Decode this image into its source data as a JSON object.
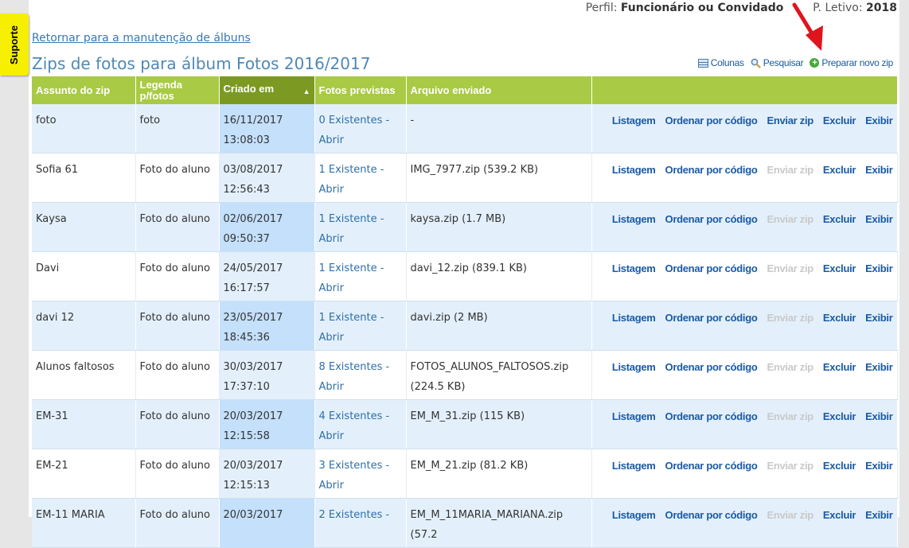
{
  "support": {
    "label": "Suporte"
  },
  "profile": {
    "perfil_label": "Perfil:",
    "perfil_value": "Funcionário ou Convidado",
    "letivo_label": "P. Letivo:",
    "letivo_value": "2018"
  },
  "nav": {
    "back_link": "Retornar para a manutenção de álbuns"
  },
  "page": {
    "title": "Zips de fotos para álbum Fotos 2016/2017"
  },
  "toolbar": {
    "columns": "Colunas",
    "search": "Pesquisar",
    "new_zip": "Preparar novo zip"
  },
  "table": {
    "headers": {
      "subject": "Assunto do zip",
      "caption": "Legenda p/fotos",
      "created": "Criado em",
      "photos": "Fotos previstas",
      "file": "Arquivo enviado",
      "actions": ""
    },
    "action_labels": {
      "list": "Listagem",
      "order": "Ordenar por código",
      "send": "Enviar zip",
      "delete": "Excluir",
      "show": "Exibir"
    },
    "rows": [
      {
        "subject": "foto",
        "caption": "foto",
        "date": "16/11/2017",
        "time": "13:08:03",
        "photos": "0 Existentes -",
        "open": "Abrir",
        "file": "-",
        "file2": "",
        "send_enabled": true
      },
      {
        "subject": "Sofia 61",
        "caption": "Foto do aluno",
        "date": "03/08/2017",
        "time": "12:56:43",
        "photos": "1 Existente -",
        "open": "Abrir",
        "file": "IMG_7977.zip (539.2 KB)",
        "file2": "",
        "send_enabled": false
      },
      {
        "subject": "Kaysa",
        "caption": "Foto do aluno",
        "date": "02/06/2017",
        "time": "09:50:37",
        "photos": "1 Existente -",
        "open": "Abrir",
        "file": "kaysa.zip (1.7 MB)",
        "file2": "",
        "send_enabled": false
      },
      {
        "subject": "Davi",
        "caption": "Foto do aluno",
        "date": "24/05/2017",
        "time": "16:17:57",
        "photos": "1 Existente -",
        "open": "Abrir",
        "file": "davi_12.zip (839.1 KB)",
        "file2": "",
        "send_enabled": false
      },
      {
        "subject": "davi 12",
        "caption": "Foto do aluno",
        "date": "23/05/2017",
        "time": "18:45:36",
        "photos": "1 Existente -",
        "open": "Abrir",
        "file": "davi.zip (2 MB)",
        "file2": "",
        "send_enabled": false
      },
      {
        "subject": "Alunos faltosos",
        "caption": "Foto do aluno",
        "date": "30/03/2017",
        "time": "17:37:10",
        "photos": "8 Existentes -",
        "open": "Abrir",
        "file": "FOTOS_ALUNOS_FALTOSOS.zip",
        "file2": "(224.5 KB)",
        "send_enabled": false
      },
      {
        "subject": "EM-31",
        "caption": "Foto do aluno",
        "date": "20/03/2017",
        "time": "12:15:58",
        "photos": "4 Existentes -",
        "open": "Abrir",
        "file": "EM_M_31.zip (115 KB)",
        "file2": "",
        "send_enabled": false
      },
      {
        "subject": "EM-21",
        "caption": "Foto do aluno",
        "date": "20/03/2017",
        "time": "12:15:13",
        "photos": "3 Existentes -",
        "open": "Abrir",
        "file": "EM_M_21.zip (81.2 KB)",
        "file2": "",
        "send_enabled": false
      },
      {
        "subject": "EM-11 MARIA",
        "caption": "Foto do aluno",
        "date": "20/03/2017",
        "time": "",
        "photos": "2 Existentes -",
        "open": "",
        "file": "EM_M_11MARIA_MARIANA.zip (57.2",
        "file2": "",
        "send_enabled": false
      }
    ]
  },
  "colors": {
    "header_green": "#a9ca44",
    "sorted_header": "#7c9a22",
    "link_blue": "#1a5aa6",
    "row_blue": "#e3f0fb",
    "sorted_cell": "#c4e0fb",
    "arrow_red": "#e0141c"
  },
  "icons": {
    "columns": "columns-icon",
    "search": "magnifier-icon",
    "new_zip": "plus-circle-icon",
    "annotation": "red-arrow-icon"
  }
}
